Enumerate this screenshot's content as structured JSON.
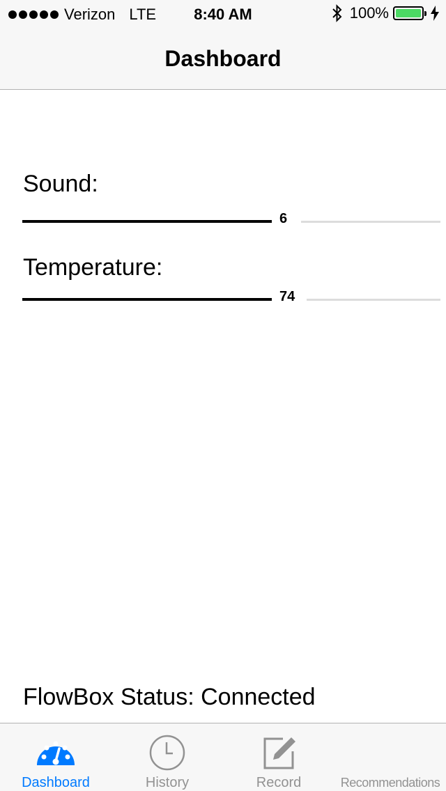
{
  "status_bar": {
    "carrier": "Verizon",
    "network": "LTE",
    "time": "8:40 AM",
    "battery": "100%",
    "battery_level": 1.0
  },
  "nav": {
    "title": "Dashboard"
  },
  "metrics": [
    {
      "label": "Sound:",
      "value": "6"
    },
    {
      "label": "Temperature:",
      "value": "74"
    }
  ],
  "status_text": "FlowBox Status: Connected",
  "tabs": [
    {
      "label": "Dashboard",
      "icon": "dashboard-gauge-icon",
      "active": true
    },
    {
      "label": "History",
      "icon": "clock-icon",
      "active": false
    },
    {
      "label": "Record",
      "icon": "compose-pencil-icon",
      "active": false
    },
    {
      "label": "Recommendations",
      "icon": "recommendations-icon",
      "active": false
    }
  ],
  "colors": {
    "accent": "#007aff",
    "inactive": "#929292",
    "battery": "#4cd964",
    "bar_background": "#f7f7f7"
  }
}
